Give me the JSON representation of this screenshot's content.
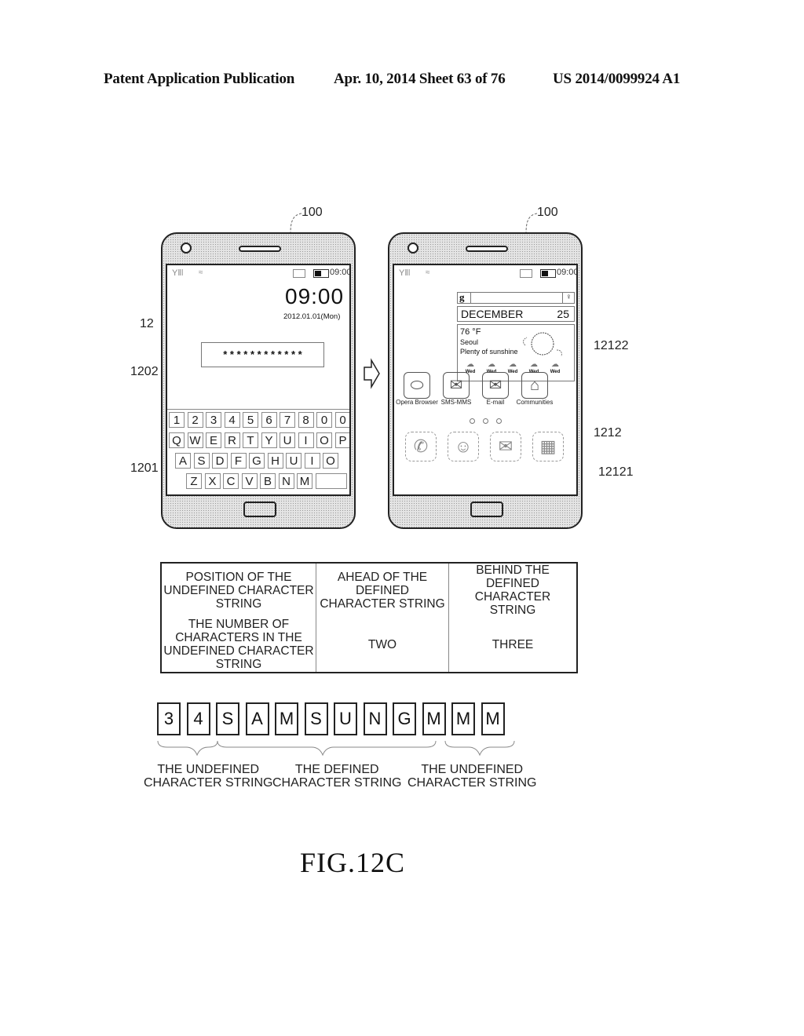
{
  "header": {
    "left": "Patent Application Publication",
    "middle": "Apr. 10, 2014  Sheet 63 of 76",
    "right": "US 2014/0099924 A1"
  },
  "phone_left": {
    "ref_device": "100",
    "ref_screen": "12",
    "ref_input": "1202",
    "ref_keyboard": "1201",
    "status_time": "09:00",
    "clock": "09:00",
    "date": "2012.01.01(Mon)",
    "password": "* * * * * * * * * * * *",
    "keyboard_rows": [
      [
        "1",
        "2",
        "3",
        "4",
        "5",
        "6",
        "7",
        "8",
        "0",
        "0"
      ],
      [
        "Q",
        "W",
        "E",
        "R",
        "T",
        "Y",
        "U",
        "I",
        "O",
        "P"
      ],
      [
        "A",
        "S",
        "D",
        "F",
        "G",
        "H",
        "U",
        "I",
        "O"
      ],
      [
        "Z",
        "X",
        "C",
        "V",
        "B",
        "N",
        "M",
        ""
      ]
    ]
  },
  "phone_right": {
    "ref_device": "100",
    "ref_widget": "12122",
    "ref_home": "1212",
    "ref_dock": "12121",
    "status_time": "09:00",
    "search_logo": "g",
    "calendar_month": "DECEMBER",
    "calendar_day": "25",
    "weather_temp": "76 °F",
    "weather_city": "Seoul",
    "weather_desc": "Plenty of sunshine",
    "forecast_days": [
      "Wed",
      "Wed",
      "Wed",
      "Wed",
      "Wed"
    ],
    "apps": [
      {
        "label": "Opera Browser",
        "icon": "opera-icon"
      },
      {
        "label": "SMS-MMS",
        "icon": "sms-icon"
      },
      {
        "label": "E-mail",
        "icon": "email-icon"
      },
      {
        "label": "Communities",
        "icon": "communities-icon"
      }
    ],
    "dock": [
      "phone-icon",
      "contacts-icon",
      "message-icon",
      "apps-grid-icon"
    ]
  },
  "table": {
    "header_row": [
      "POSITION OF THE UNDEFINED CHARACTER STRING",
      "AHEAD OF THE DEFINED CHARACTER STRING",
      "BEHIND THE DEFINED CHARACTER STRING"
    ],
    "data_row": [
      "THE NUMBER OF CHARACTERS IN THE UNDEFINED CHARACTER STRING",
      "TWO",
      "THREE"
    ]
  },
  "char_string": {
    "chars": [
      "3",
      "4",
      "S",
      "A",
      "M",
      "S",
      "U",
      "N",
      "G",
      "M",
      "M",
      "M"
    ],
    "groups": [
      "THE UNDEFINED\nCHARACTER STRING",
      "THE DEFINED\nCHARACTER STRING",
      "THE UNDEFINED\nCHARACTER STRING"
    ]
  },
  "figure_label": "FIG.12C"
}
